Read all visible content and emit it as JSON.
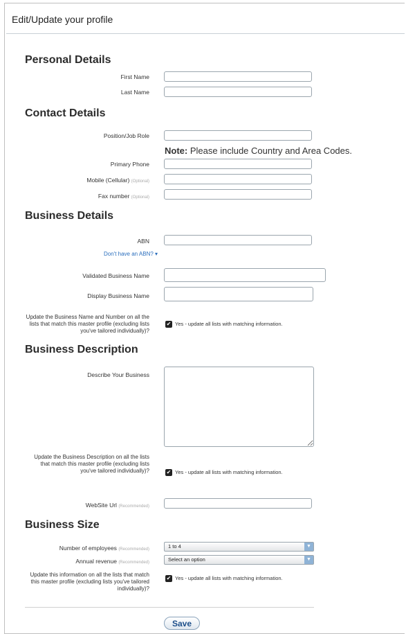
{
  "page_title": "Edit/Update your profile",
  "sections": {
    "personal": "Personal Details",
    "contact": "Contact Details",
    "business": "Business Details",
    "description": "Business Description",
    "size": "Business Size"
  },
  "personal": {
    "first_name_label": "First Name",
    "first_name_value": "",
    "last_name_label": "Last Name",
    "last_name_value": ""
  },
  "contact": {
    "position_label": "Position/Job Role",
    "position_value": "",
    "note_bold": "Note:",
    "note_text": "Please include Country and Area Codes.",
    "primary_phone_label": "Primary Phone",
    "primary_phone_value": "",
    "mobile_label": "Mobile (Cellular)",
    "mobile_hint": "(Optional)",
    "mobile_value": "",
    "fax_label": "Fax number",
    "fax_hint": "(Optional)",
    "fax_value": ""
  },
  "business": {
    "abn_label": "ABN",
    "abn_value": "",
    "no_abn_link": "Don't have an ABN? ▾",
    "validated_name_label": "Validated Business Name",
    "validated_name_value": "",
    "display_name_label": "Display Business Name",
    "display_name_value": "",
    "update_name_label": "Update the Business Name and Number on all the lists that match this master profile (excluding lists you've tailored individually)?",
    "update_name_checkbox": "Yes - update all lists with matching information."
  },
  "description": {
    "describe_label": "Describe Your Business",
    "describe_value": "",
    "update_desc_label": "Update the Business Description on all the lists that match this master profile (excluding lists you've tailored individually)?",
    "update_desc_checkbox": "Yes - update all lists with matching information.",
    "website_label": "WebSite Url",
    "website_hint": "(Recommended)",
    "website_value": ""
  },
  "size": {
    "employees_label": "Number of employees",
    "employees_hint": "(Recommended)",
    "employees_value": "1 to 4",
    "revenue_label": "Annual revenue",
    "revenue_hint": "(Recommended)",
    "revenue_value": "Select an option",
    "update_size_label": "Update this information on all the lists that match this master profile (excluding lists you've tailored individually)?",
    "update_size_checkbox": "Yes - update all lists with matching information."
  },
  "save_label": "Save",
  "icons": {
    "checkbox": "check-icon",
    "dropdown": "chevron-down-icon"
  }
}
